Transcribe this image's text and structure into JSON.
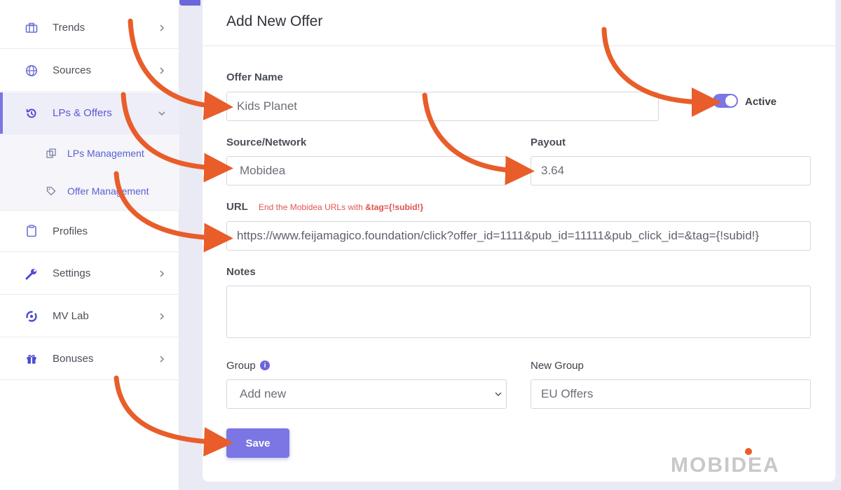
{
  "sidebar": {
    "items": [
      {
        "label": "Trends",
        "icon": "briefcase-icon"
      },
      {
        "label": "Sources",
        "icon": "globe-icon"
      },
      {
        "label": "LPs & Offers",
        "icon": "history-icon"
      },
      {
        "label": "Profiles",
        "icon": "clipboard-icon"
      },
      {
        "label": "Settings",
        "icon": "wrench-icon"
      },
      {
        "label": "MV Lab",
        "icon": "lab-icon"
      },
      {
        "label": "Bonuses",
        "icon": "gift-icon"
      }
    ],
    "sub_items": [
      {
        "label": "LPs Management",
        "icon": "copy-icon"
      },
      {
        "label": "Offer Management",
        "icon": "tag-icon"
      }
    ]
  },
  "form": {
    "title": "Add New Offer",
    "offer_name_label": "Offer Name",
    "offer_name_value": "Kids Planet",
    "active_label": "Active",
    "source_label": "Source/Network",
    "source_value": "Mobidea",
    "payout_label": "Payout",
    "payout_value": "3.64",
    "url_label": "URL",
    "url_hint_prefix": "End the Mobidea URLs with ",
    "url_hint_code": "&tag={!subid!}",
    "url_value": "https://www.feijamagico.foundation/click?offer_id=1111&pub_id=11111&pub_click_id=&tag={!subid!}",
    "notes_label": "Notes",
    "notes_value": "",
    "group_label": "Group",
    "group_value": "Add new",
    "new_group_label": "New Group",
    "new_group_value": "EU Offers",
    "save_label": "Save"
  },
  "brand": {
    "logo_text": "MOBIDEA",
    "accent": "#7b76e3",
    "arrow_color": "#e85d2a"
  }
}
